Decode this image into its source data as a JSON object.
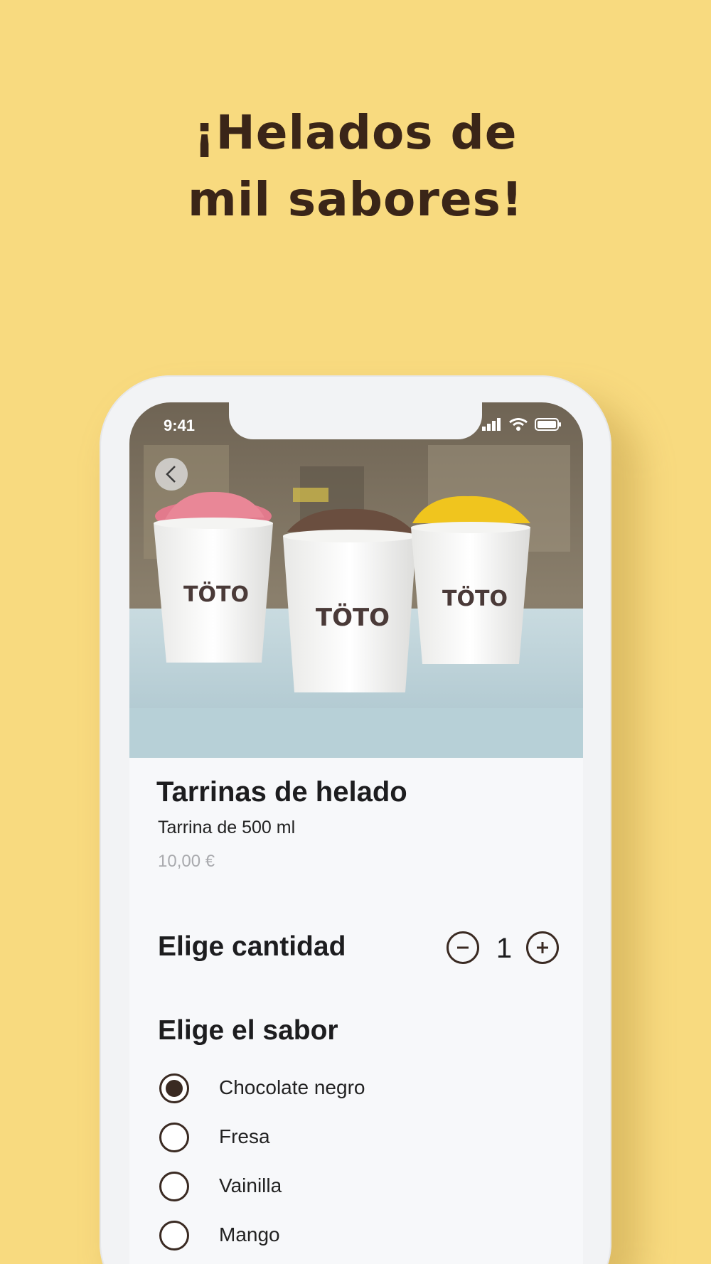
{
  "headline": {
    "line1": "¡Helados de",
    "line2": "mil sabores!"
  },
  "status_bar": {
    "time": "9:41",
    "icons": [
      "signal-icon",
      "wifi-icon",
      "battery-icon"
    ]
  },
  "hero": {
    "back_icon": "chevron-left-icon",
    "brand_on_cups": "TÖTO"
  },
  "product": {
    "title": "Tarrinas de helado",
    "subtitle": "Tarrina de 500 ml",
    "price": "10,00 €"
  },
  "quantity": {
    "label": "Elige cantidad",
    "value": "1",
    "minus_icon": "minus-circle-icon",
    "plus_icon": "plus-circle-icon"
  },
  "flavor": {
    "label": "Elige el sabor",
    "options": [
      {
        "label": "Chocolate negro",
        "selected": true
      },
      {
        "label": "Fresa",
        "selected": false
      },
      {
        "label": "Vainilla",
        "selected": false
      },
      {
        "label": "Mango",
        "selected": false
      }
    ]
  },
  "colors": {
    "background": "#f8da7f",
    "headline": "#3a2518",
    "accent": "#3a2a22",
    "price": "#a9aaae"
  }
}
